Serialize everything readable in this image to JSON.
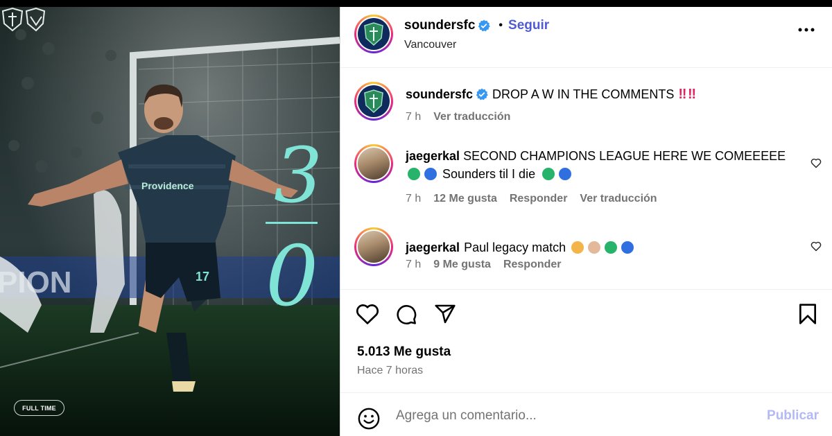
{
  "post": {
    "author": "soundersfc",
    "follow_label": "Seguir",
    "separator": "•",
    "location": "Vancouver",
    "image": {
      "score_home": "3",
      "score_away": "0",
      "badge": "FULL TIME",
      "sponsor": "Providence",
      "banner": "PION",
      "jersey_number": "17"
    }
  },
  "caption": {
    "username": "soundersfc",
    "text": "DROP A W IN THE COMMENTS",
    "emoji": "‼ ‼",
    "time": "7 h",
    "translate": "Ver traducción"
  },
  "comments": [
    {
      "username": "jaegerkal",
      "text_line1": "SECOND CHAMPIONS LEAGUE HERE WE COMEEEEE",
      "text_line2": "Sounders til I die",
      "time": "7 h",
      "likes": "12 Me gusta",
      "reply": "Responder",
      "translate": "Ver traducción"
    },
    {
      "username": "jaegerkal",
      "text_line1": "Paul legacy match",
      "time": "7 h",
      "likes": "9 Me gusta",
      "reply": "Responder"
    }
  ],
  "stats": {
    "likes": "5.013 Me gusta",
    "time_ago": "Hace 7 horas"
  },
  "composer": {
    "placeholder": "Agrega un comentario...",
    "post_label": "Publicar"
  },
  "colors": {
    "accent": "#4f5bd5",
    "muted": "#737373",
    "score": "#7fe3d5",
    "post_disabled": "#b3b9f4"
  },
  "icons": {
    "verified": "verified-badge-icon",
    "more": "more-options-icon",
    "like": "heart-icon",
    "comment": "comment-bubble-icon",
    "share": "paper-plane-icon",
    "save": "bookmark-icon",
    "emoji": "smiley-icon"
  }
}
